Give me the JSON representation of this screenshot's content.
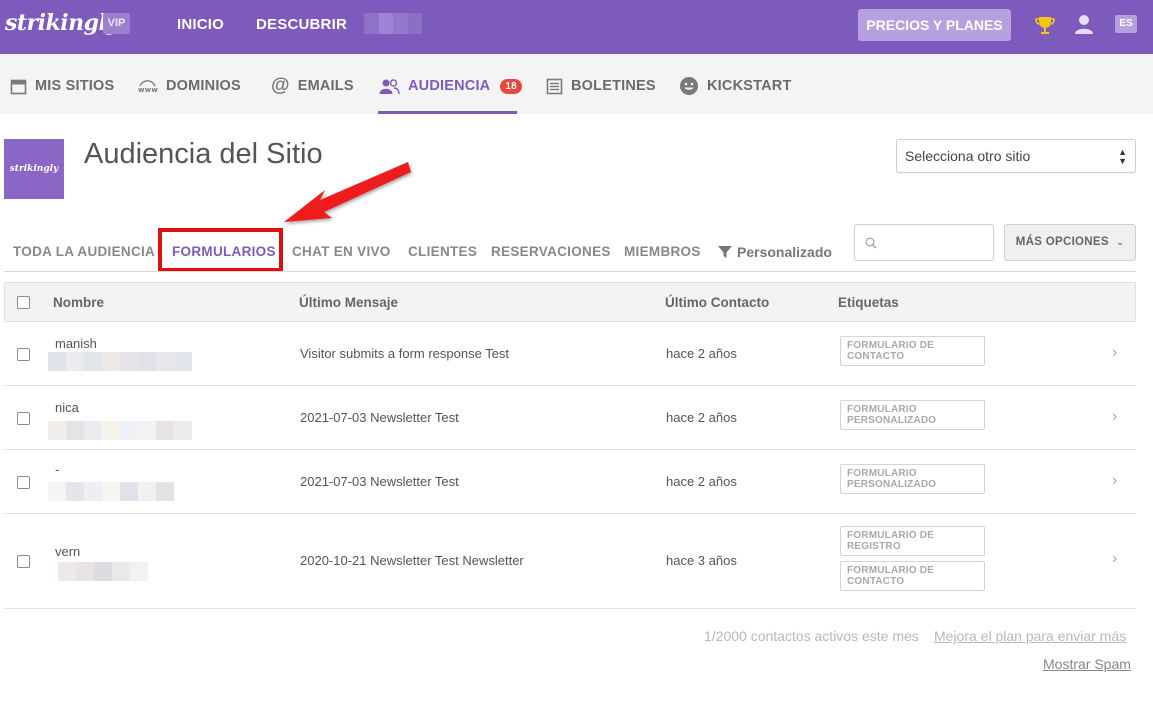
{
  "topbar": {
    "logo": "strikingly",
    "vip": "VIP",
    "nav": [
      "INICIO",
      "DESCUBRIR"
    ],
    "pricing_button": "PRECIOS Y PLANES",
    "language": "ES",
    "icons": [
      "trophy-icon",
      "user-icon"
    ],
    "accent_color": "#7d5bbd"
  },
  "subnav": {
    "items": [
      {
        "label": "MIS SITIOS",
        "icon": "calendar-icon"
      },
      {
        "label": "DOMINIOS",
        "icon": "www-icon"
      },
      {
        "label": "EMAILS",
        "icon": "at-icon"
      },
      {
        "label": "AUDIENCIA",
        "icon": "audience-icon",
        "badge": "18",
        "active": true
      },
      {
        "label": "BOLETINES",
        "icon": "newsletter-icon"
      },
      {
        "label": "KICKSTART",
        "icon": "smiley-icon"
      }
    ]
  },
  "header": {
    "site_thumb": "strikingly",
    "title": "Audiencia del Sitio",
    "site_select": "Selecciona otro sitio"
  },
  "filters": {
    "tabs": [
      "TODA LA AUDIENCIA",
      "FORMULARIOS",
      "CHAT EN VIVO",
      "CLIENTES",
      "RESERVACIONES",
      "MIEMBROS"
    ],
    "active_tab": "FORMULARIOS",
    "custom": "Personalizado",
    "search_placeholder": "",
    "more_options": "MÁS OPCIONES"
  },
  "table": {
    "columns": [
      "Nombre",
      "Último Mensaje",
      "Último Contacto",
      "Etiquetas"
    ],
    "rows": [
      {
        "name": "manish",
        "message": "Visitor submits a form response Test",
        "contact": "hace 2 años",
        "tags": [
          "FORMULARIO DE CONTACTO"
        ]
      },
      {
        "name": "nica",
        "message": "2021-07-03 Newsletter Test",
        "contact": "hace 2 años",
        "tags": [
          "FORMULARIO PERSONALIZADO"
        ]
      },
      {
        "name": "-",
        "message": "2021-07-03 Newsletter Test",
        "contact": "hace 2 años",
        "tags": [
          "FORMULARIO PERSONALIZADO"
        ]
      },
      {
        "name": "vern",
        "message": "2020-10-21 Newsletter Test Newsletter",
        "contact": "hace 3 años",
        "tags": [
          "FORMULARIO DE REGISTRO",
          "FORMULARIO DE CONTACTO"
        ]
      }
    ]
  },
  "footer": {
    "contacts": "1/2000 contactos activos este mes",
    "upgrade_link": "Mejora el plan para enviar más",
    "spam_link": "Mostrar Spam"
  }
}
